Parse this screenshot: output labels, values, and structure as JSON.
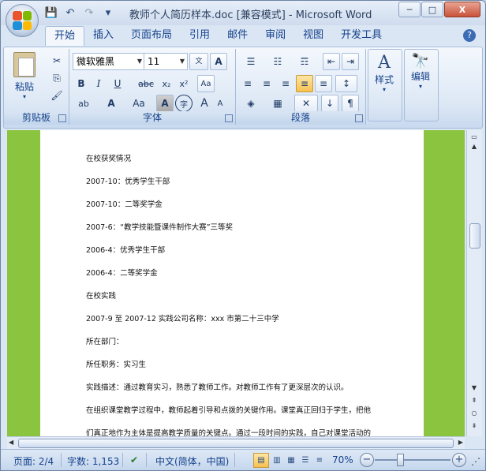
{
  "window": {
    "title": "教师个人简历样本.doc [兼容模式] - Microsoft Word",
    "minimize": "─",
    "maximize": "□",
    "close": "X"
  },
  "quick_access": {
    "save": "💾",
    "undo": "↶",
    "redo": "↷",
    "customize": "▾"
  },
  "tabs": [
    "开始",
    "插入",
    "页面布局",
    "引用",
    "邮件",
    "审阅",
    "视图",
    "开发工具"
  ],
  "help": "?",
  "ribbon": {
    "clipboard": {
      "label": "剪贴板",
      "paste": "粘贴",
      "cut": "✂",
      "copy": "⎘",
      "format_painter": "🖌"
    },
    "font": {
      "label": "字体",
      "font_name": "微软雅黑",
      "font_size": "11",
      "phonetic": "wén\n文",
      "border_a": "A",
      "bold": "B",
      "italic": "I",
      "underline": "U",
      "strike": "abc",
      "subscript": "x₂",
      "superscript": "x²",
      "clear": "Aa",
      "highlight": "ab",
      "font_color": "A",
      "case": "Aa",
      "char_shade": "A",
      "enclose": "字",
      "grow": "A",
      "shrink": "A"
    },
    "paragraph": {
      "label": "段落",
      "bullets": "☰",
      "numbering": "☷",
      "multilevel": "☶",
      "decrease_indent": "⇤",
      "increase_indent": "⇥",
      "align_left": "≡",
      "center": "≡",
      "align_right": "≡",
      "justify": "≡",
      "distributed": "≡",
      "line_spacing": "↕",
      "shading": "◈",
      "borders": "▦",
      "chinese_layout": "✕",
      "sort": "↓",
      "show_marks": "¶"
    },
    "styles": {
      "label": "样式",
      "icon": "A"
    },
    "editing": {
      "label": "编辑",
      "icon": "🔭"
    }
  },
  "document": {
    "lines": [
      "在校获奖情况",
      "2007-10：优秀学生干部",
      "2007-10：二等奖学金",
      "2007-6：“教学技能暨课件制作大赛”三等奖",
      "2006-4：优秀学生干部",
      "2006-4：二等奖学金",
      "在校实践",
      "2007-9 至 2007-12 实践公司名称：xxx 市第二十三中学",
      "所在部门：",
      "所任职务：实习生",
      "实践描述：通过教育实习，熟悉了教师工作。对教师工作有了更深层次的认识。",
      "在组织课堂教学过程中，教师起着引导和点拨的关键作用。课堂真正回归于学生，把他",
      "们真正地作为主体是提高教学质量的关键点。通过一段时间的实践，自己对课堂活动的"
    ]
  },
  "status": {
    "page": "页面: 2/4",
    "words": "字数: 1,153",
    "proof": "✔",
    "language": "中文(简体，中国)",
    "zoom": "70%",
    "zoom_out": "−",
    "zoom_in": "+"
  },
  "colors": {
    "page_bg": "#8bc43f",
    "ribbon_text": "#15428b",
    "highlight": "#f7e43a",
    "font_color": "#e22a2a"
  }
}
